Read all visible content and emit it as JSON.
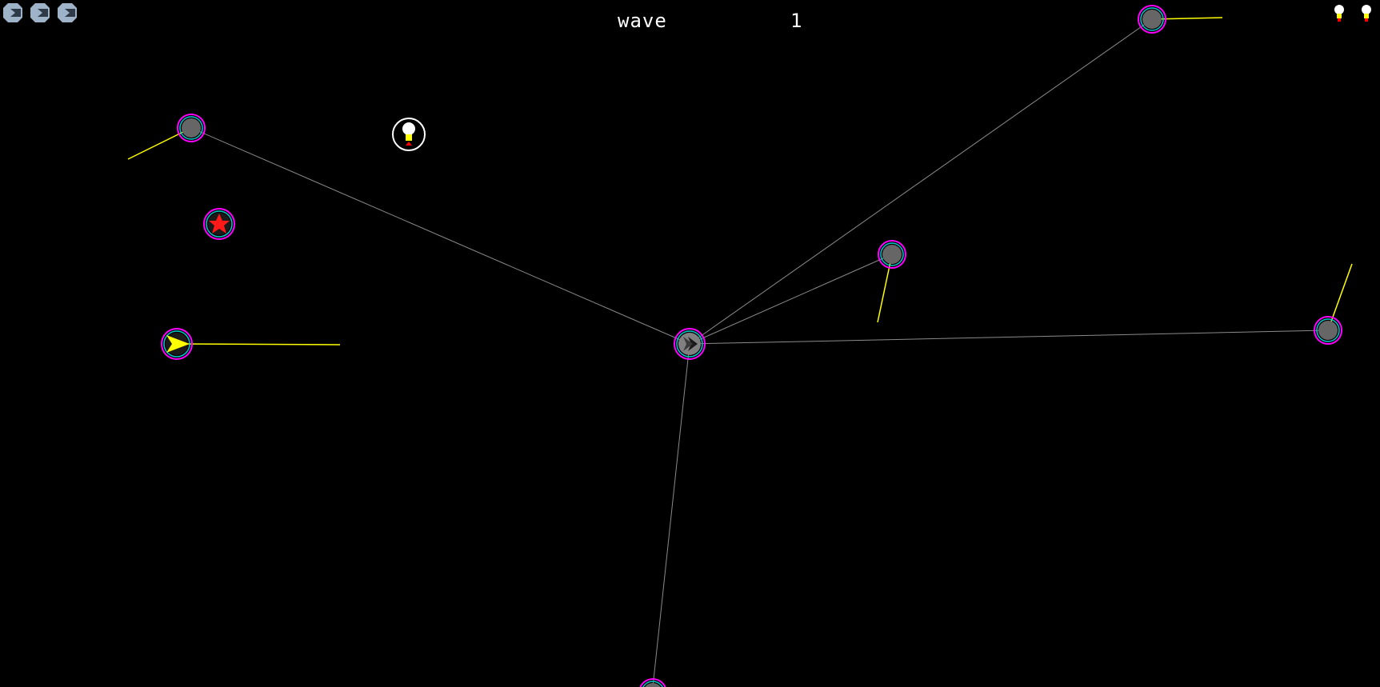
{
  "hud": {
    "wave_label": "wave",
    "wave_number": "1",
    "lives_remaining": 3,
    "bombs_remaining": 2
  },
  "colors": {
    "background": "#000000",
    "node_fill": "#666666",
    "node_ring_outer": "#ff00ff",
    "node_ring_inner": "#00c8c8",
    "link_line": "#8a8a8a",
    "laser": "#ffff00",
    "enemy_star": "#ff1a1a",
    "player_arrow": "#ffff00",
    "hud_text": "#ffffff",
    "life_icon": "#9fb3c8"
  },
  "icons": {
    "life": "cube-icon",
    "bomb": "bomb-icon",
    "powerup": "bomb-pickup-icon",
    "hub": "hub-arrow-icon",
    "enemy": "red-star-icon",
    "player": "player-arrow-icon"
  }
}
